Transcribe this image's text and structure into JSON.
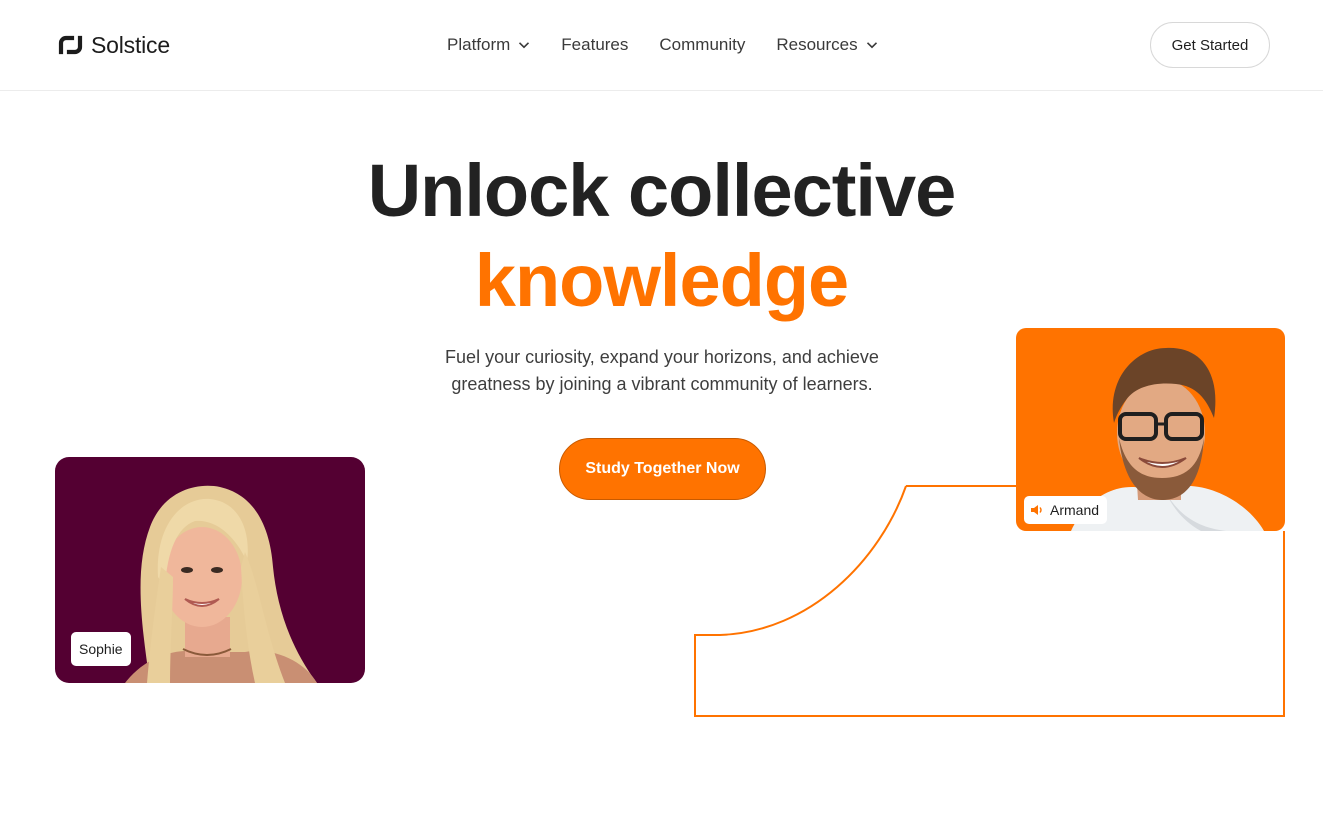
{
  "brand": {
    "name": "Solstice"
  },
  "nav": {
    "items": [
      {
        "label": "Platform",
        "has_dropdown": true
      },
      {
        "label": "Features",
        "has_dropdown": false
      },
      {
        "label": "Community",
        "has_dropdown": false
      },
      {
        "label": "Resources",
        "has_dropdown": true
      }
    ],
    "cta_label": "Get Started"
  },
  "hero": {
    "title_line1": "Unlock collective",
    "title_line2": "knowledge",
    "subtitle": "Fuel your curiosity, expand your horizons, and achieve greatness by joining a vibrant community of learners.",
    "cta_label": "Study Together Now"
  },
  "participants": [
    {
      "name": "Sophie",
      "card_color": "#540032"
    },
    {
      "name": "Armand",
      "card_color": "#ff7300",
      "icon": "speaker-icon"
    }
  ],
  "colors": {
    "accent": "#ff7300",
    "text": "#222222",
    "sophie_bg": "#540032"
  }
}
